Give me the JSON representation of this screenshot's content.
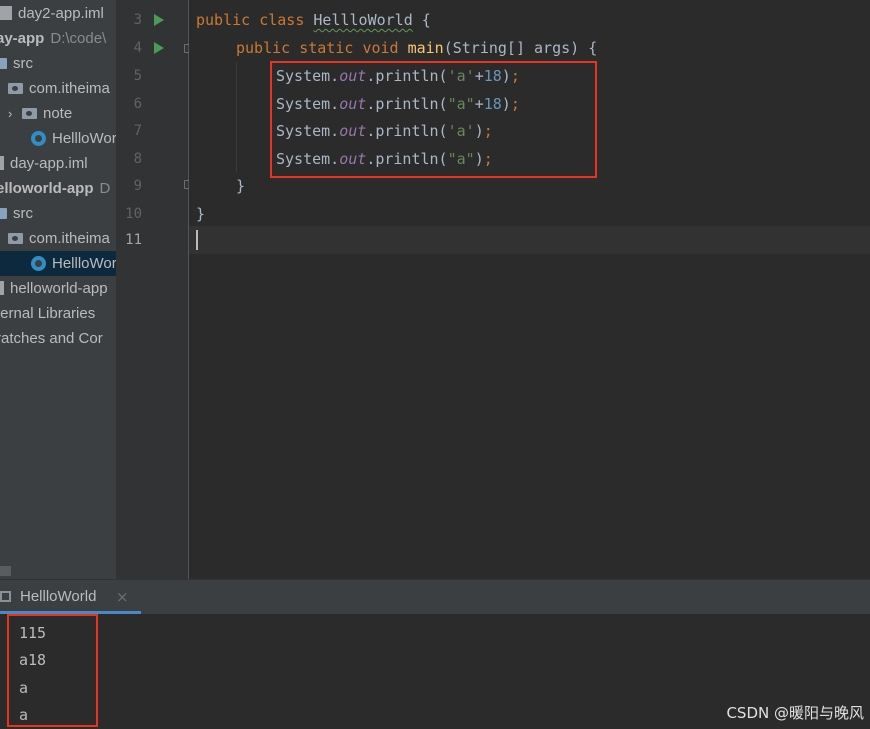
{
  "project_tree": {
    "items": [
      {
        "label": "day2-app.iml",
        "hint": "",
        "icon": "iml-file-icon",
        "bold": false,
        "selected": false
      },
      {
        "label": "ay-app",
        "hint": "D:\\code\\",
        "icon": "",
        "bold": true,
        "selected": false
      },
      {
        "label": "src",
        "hint": "",
        "icon": "src-folder-icon",
        "bold": false,
        "selected": false
      },
      {
        "label": "com.itheima",
        "hint": "",
        "icon": "package-icon",
        "bold": false,
        "selected": false
      },
      {
        "label": "note",
        "hint": "",
        "icon": "package-icon",
        "bold": false,
        "selected": false
      },
      {
        "label": "HellloWorld",
        "hint": "",
        "icon": "java-class-icon",
        "bold": false,
        "selected": false
      },
      {
        "label": "day-app.iml",
        "hint": "",
        "icon": "iml-file-icon",
        "bold": false,
        "selected": false
      },
      {
        "label": "elloworld-app",
        "hint": "D",
        "icon": "",
        "bold": true,
        "selected": false
      },
      {
        "label": "src",
        "hint": "",
        "icon": "src-folder-icon",
        "bold": false,
        "selected": false
      },
      {
        "label": "com.itheima",
        "hint": "",
        "icon": "package-icon",
        "bold": false,
        "selected": false
      },
      {
        "label": "HellloWorld",
        "hint": "",
        "icon": "java-class-icon",
        "bold": false,
        "selected": true
      },
      {
        "label": "helloworld-app",
        "hint": "",
        "icon": "iml-file-icon",
        "bold": false,
        "selected": false
      },
      {
        "label": "ternal Libraries",
        "hint": "",
        "icon": "",
        "bold": false,
        "selected": false
      },
      {
        "label": "ratches and Cor",
        "hint": "",
        "icon": "",
        "bold": false,
        "selected": false
      }
    ]
  },
  "editor": {
    "line_numbers": [
      "3",
      "4",
      "5",
      "6",
      "7",
      "8",
      "9",
      "10",
      "11"
    ],
    "lines": {
      "l3": {
        "kw1": "public",
        "kw2": "class",
        "cls": "HellloWorld",
        "rest": " {"
      },
      "l4": {
        "kw1": "public",
        "kw2": "static",
        "kw3": "void",
        "fn": "main",
        "p1": "(String[] args) {"
      },
      "l5": {
        "a": "System.",
        "b": "out",
        "c": ".println(",
        "d": "'a'",
        "e": "+",
        "f": "18",
        "g": ")",
        "h": ";"
      },
      "l6": {
        "a": "System.",
        "b": "out",
        "c": ".println(",
        "d": "\"a\"",
        "e": "+",
        "f": "18",
        "g": ")",
        "h": ";"
      },
      "l7": {
        "a": "System.",
        "b": "out",
        "c": ".println(",
        "d": "'a'",
        "g": ")",
        "h": ";"
      },
      "l8": {
        "a": "System.",
        "b": "out",
        "c": ".println(",
        "d": "\"a\"",
        "g": ")",
        "h": ";"
      },
      "l9": {
        "text": "}"
      },
      "l10": {
        "text": "}"
      }
    }
  },
  "run_panel": {
    "tab_label": "HellloWorld",
    "close_glyph": "×",
    "output": [
      "115",
      "a18",
      "a",
      "a"
    ]
  },
  "watermark": "CSDN @暖阳与晚风",
  "colors": {
    "highlight_box": "#e8341f",
    "keyword": "#cc7832",
    "string": "#6a8759",
    "number": "#6897bb",
    "field": "#9876aa"
  }
}
